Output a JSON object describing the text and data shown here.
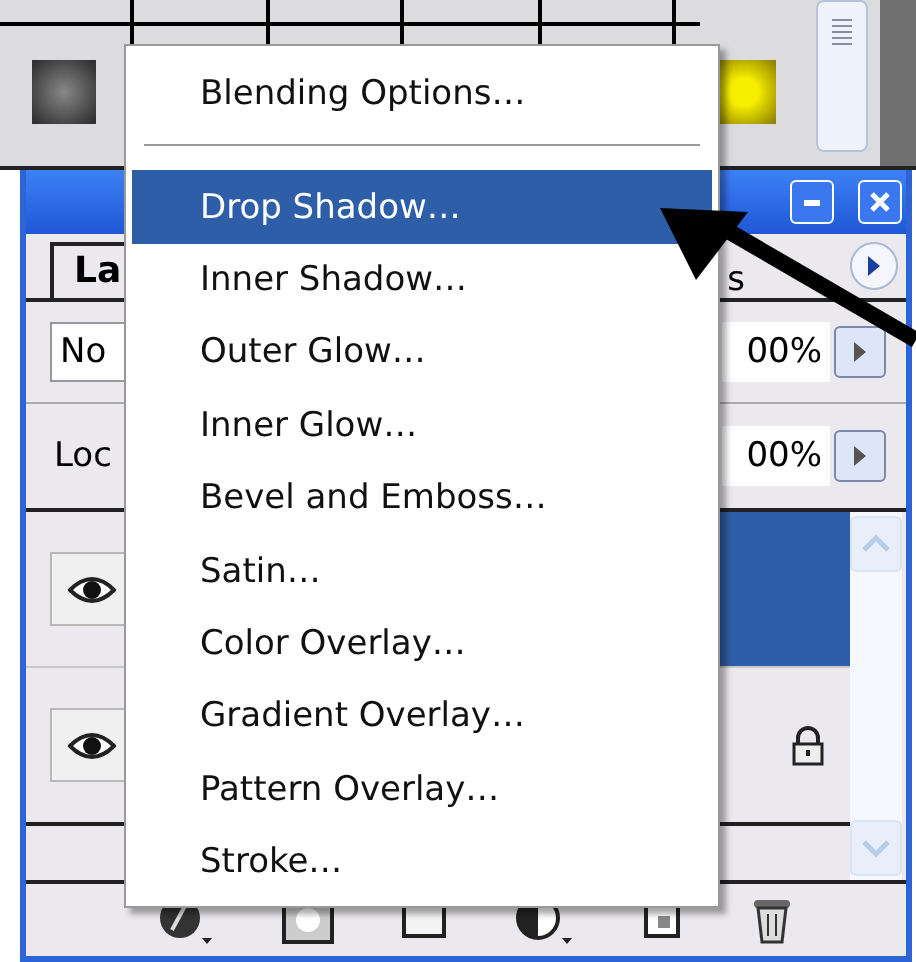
{
  "panel": {
    "tabs": [
      {
        "label": "La",
        "selected": true
      },
      {
        "label": "s",
        "selected": false
      }
    ],
    "blend_mode": "No",
    "opacity": "00%",
    "lock_label": "Loc",
    "fill": "00%",
    "layers": [
      {
        "selected": true,
        "visible": true,
        "locked": false
      },
      {
        "selected": false,
        "visible": true,
        "locked": true
      }
    ]
  },
  "menu": {
    "header": "Blending Options…",
    "items": [
      {
        "label": "Drop Shadow…",
        "selected": true
      },
      {
        "label": "Inner Shadow…",
        "selected": false
      },
      {
        "label": "Outer Glow…",
        "selected": false
      },
      {
        "label": "Inner Glow…",
        "selected": false
      },
      {
        "label": "Bevel and Emboss…",
        "selected": false
      },
      {
        "label": "Satin…",
        "selected": false
      },
      {
        "label": "Color Overlay…",
        "selected": false
      },
      {
        "label": "Gradient Overlay…",
        "selected": false
      },
      {
        "label": "Pattern Overlay…",
        "selected": false
      },
      {
        "label": "Stroke…",
        "selected": false
      }
    ]
  }
}
